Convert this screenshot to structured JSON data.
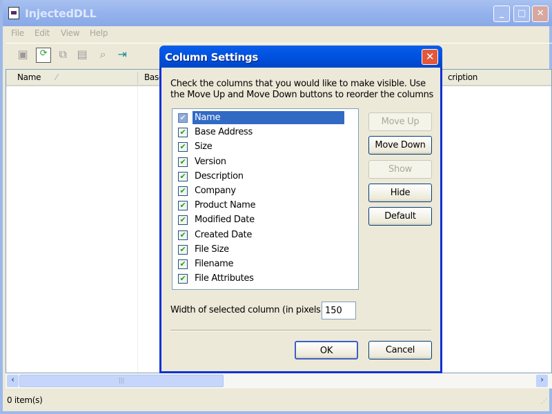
{
  "window": {
    "title": "InjectedDLL",
    "minimize": "_",
    "maximize": "□",
    "close": "✕"
  },
  "menu": [
    "File",
    "Edit",
    "View",
    "Help"
  ],
  "toolbar": [
    "save-icon",
    "refresh-icon",
    "copy-icon",
    "properties-icon",
    "find-icon",
    "exit-icon"
  ],
  "list": {
    "columns": [
      "Name",
      "Base",
      "cription"
    ]
  },
  "status": {
    "text": "0 item(s)"
  },
  "dialog": {
    "title": "Column Settings",
    "close": "✕",
    "instructions": "Check the columns that you would like to make visible. Use the Move Up and Move Down buttons to reorder the columns",
    "columns": [
      {
        "label": "Name",
        "checked": true,
        "selected": true
      },
      {
        "label": "Base Address",
        "checked": true
      },
      {
        "label": "Size",
        "checked": true
      },
      {
        "label": "Version",
        "checked": true
      },
      {
        "label": "Description",
        "checked": true
      },
      {
        "label": "Company",
        "checked": true
      },
      {
        "label": "Product Name",
        "checked": true
      },
      {
        "label": "Modified Date",
        "checked": true
      },
      {
        "label": "Created Date",
        "checked": true
      },
      {
        "label": "File Size",
        "checked": true
      },
      {
        "label": "Filename",
        "checked": true
      },
      {
        "label": "File Attributes",
        "checked": true
      }
    ],
    "buttons": {
      "move_up": "Move Up",
      "move_down": "Move Down",
      "show": "Show",
      "hide": "Hide",
      "default": "Default",
      "ok": "OK",
      "cancel": "Cancel"
    },
    "width_label": "Width of selected column (in pixels):",
    "width_value": "150"
  }
}
